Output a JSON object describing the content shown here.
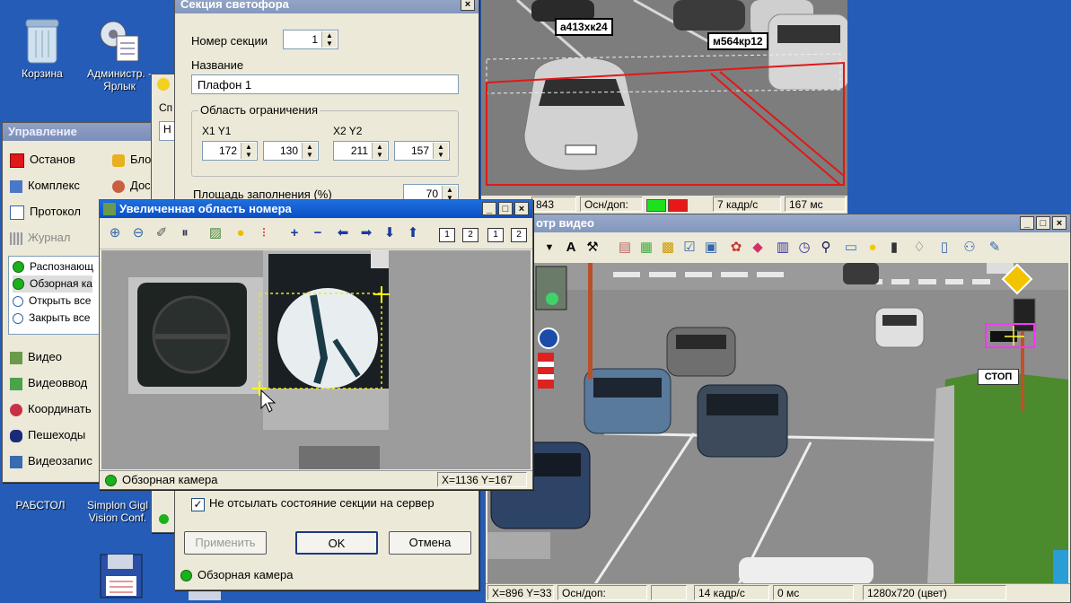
{
  "desktop": {
    "icons": [
      {
        "label": "Корзина",
        "name": "recycle-bin"
      },
      {
        "label": "Администр. - Ярлык",
        "name": "admin-shortcut"
      },
      {
        "label": "РАБСТОЛ",
        "name": "rabstol"
      },
      {
        "label": "Simplon Gigl Vision Conf.",
        "name": "simplon"
      }
    ]
  },
  "control_panel": {
    "title": "Управление",
    "items_col1": [
      "Останов",
      "Комплекс",
      "Протокол",
      "Журнал"
    ],
    "items_col2": [
      "Бло",
      "Дос"
    ],
    "list": [
      "Распознающ",
      "Обзорная ка",
      "Открыть все",
      "Закрыть все"
    ],
    "bottom": [
      "Видео",
      "Видеоввод",
      "Координать",
      "Пешеходы",
      "Видеозапис"
    ]
  },
  "small_window": {
    "cut_label_1": "Сп",
    "cut_label_2": "Н"
  },
  "section_dialog": {
    "title": "Секция светофора",
    "section_number_label": "Номер секции",
    "section_number": "1",
    "name_label": "Название",
    "name_value": "Плафон 1",
    "group_label": "Область ограничения",
    "x1y1_label": "X1 Y1",
    "x2y2_label": "X2 Y2",
    "x1": "172",
    "y1": "130",
    "x2": "211",
    "y2": "157",
    "fill_area_label": "Площадь заполнения (%)",
    "fill_area": "70",
    "checkbox_label": "Не отсылать состояние секции на сервер",
    "apply": "Применить",
    "ok": "OK",
    "cancel": "Отмена",
    "status": "Обзорная камера"
  },
  "zoom_window": {
    "title": "Увеличенная область номера",
    "status_camera": "Обзорная камера",
    "status_coords": "X=1136 Y=167",
    "btn_labels": [
      "1",
      "2",
      "1",
      "2"
    ]
  },
  "top_video": {
    "plates": [
      "а413хк24",
      "м564кр12"
    ],
    "status": {
      "coords": "843",
      "osn_dop": "Осн/доп:",
      "fps": "7 кадр/с",
      "ms": "167 мс"
    }
  },
  "bottom_video": {
    "title": "отр видео",
    "stop_sign": "СТОП",
    "status": {
      "coords": "X=896 Y=33",
      "osn_dop": "Осн/доп:",
      "fps": "14 кадр/с",
      "ms": "0 мс",
      "res": "1280x720 (цвет)"
    }
  },
  "colors": {
    "title_active": "#0a4fc5",
    "desktop": "#245cb8",
    "dialog": "#ece9d8"
  }
}
